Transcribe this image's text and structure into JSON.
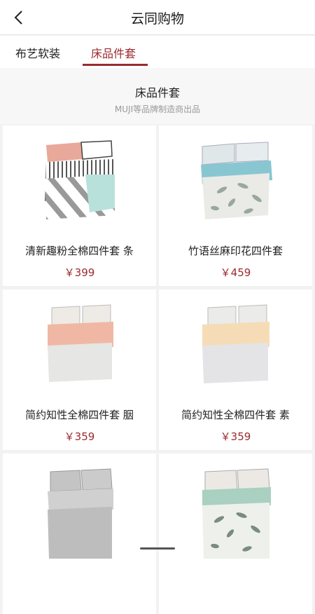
{
  "header": {
    "title": "云同购物",
    "back_icon": "back-arrow-icon"
  },
  "tabs": [
    {
      "label": "布艺软装",
      "active": false
    },
    {
      "label": "床品件套",
      "active": true
    }
  ],
  "accent": "#9b2a2f",
  "section": {
    "title": "床品件套",
    "subtitle": "MUJI等品牌制造商出品"
  },
  "products": [
    {
      "name": "清新趣粉全棉四件套 条",
      "price": "￥399"
    },
    {
      "name": "竹语丝麻印花四件套",
      "price": "￥459"
    },
    {
      "name": "简约知性全棉四件套 胭",
      "price": "￥359"
    },
    {
      "name": "简约知性全棉四件套 素",
      "price": "￥359"
    },
    {
      "name": "",
      "price": ""
    },
    {
      "name": "",
      "price": ""
    }
  ]
}
